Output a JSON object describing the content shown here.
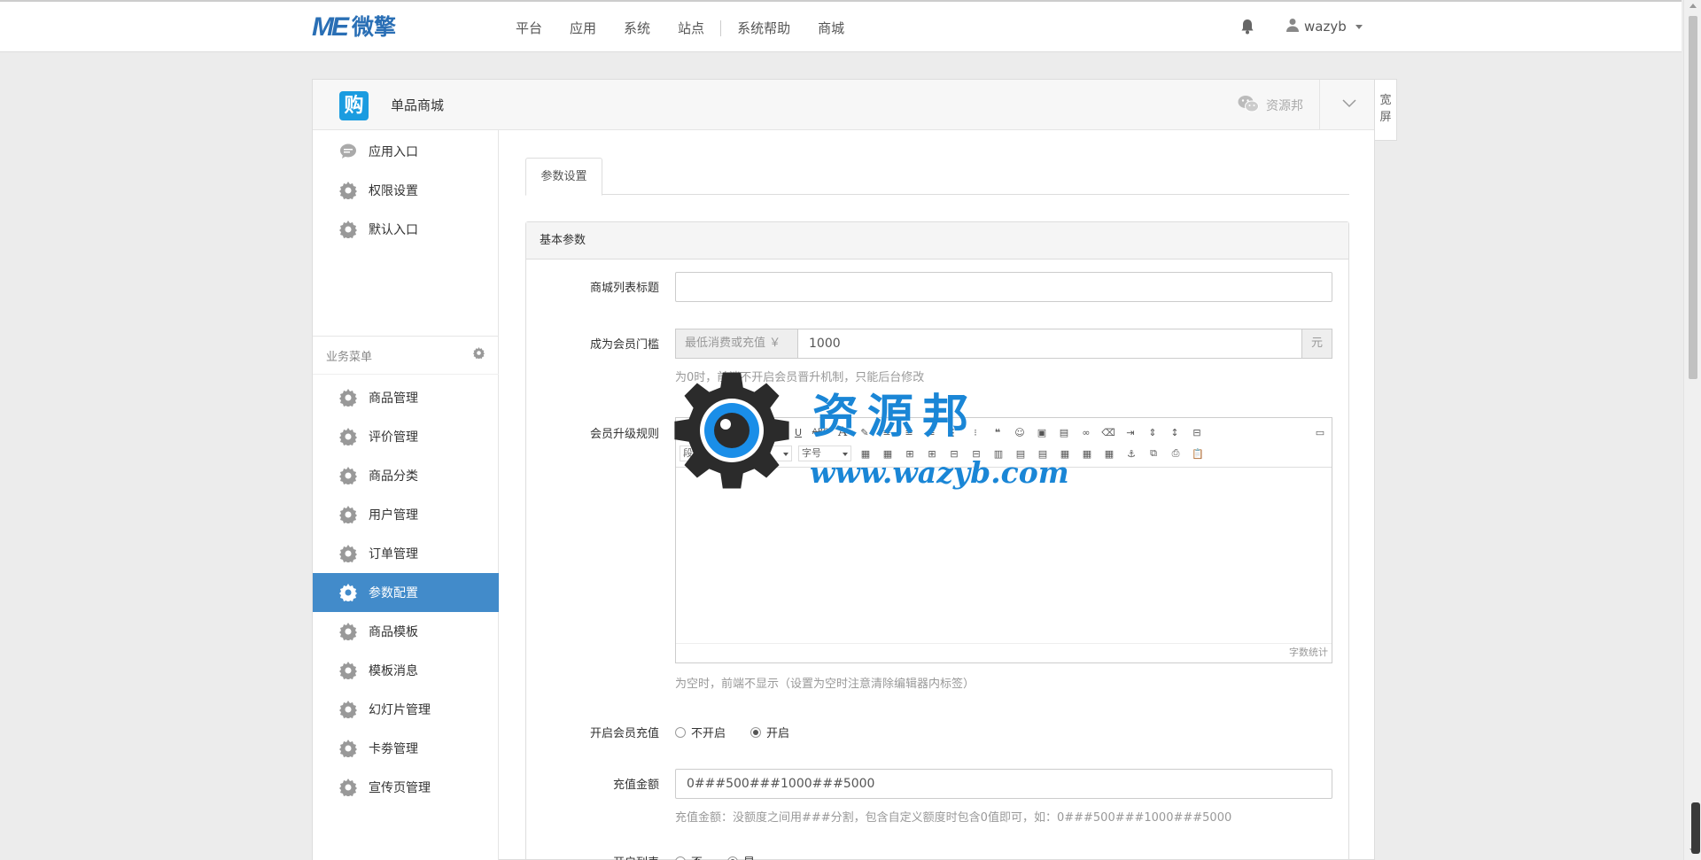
{
  "header": {
    "logo_mark": "ME",
    "logo_text": "微擎",
    "nav": [
      "平台",
      "应用",
      "系统",
      "站点",
      "系统帮助",
      "商城"
    ],
    "user": "wazyb"
  },
  "app": {
    "icon_text": "购",
    "name": "单品商城",
    "wechat_label": "资源邦",
    "wide_label_1": "宽",
    "wide_label_2": "屏"
  },
  "sidebar": {
    "top_items": [
      "应用入口",
      "权限设置",
      "默认入口"
    ],
    "group_title": "业务菜单",
    "items": [
      "商品管理",
      "评价管理",
      "商品分类",
      "用户管理",
      "订单管理",
      "参数配置",
      "商品模板",
      "模板消息",
      "幻灯片管理",
      "卡劵管理",
      "宣传页管理"
    ],
    "active": "参数配置"
  },
  "content": {
    "tab": "参数设置",
    "card_title": "基本参数",
    "fields": {
      "list_title": {
        "label": "商城列表标题",
        "value": ""
      },
      "member_threshold": {
        "label": "成为会员门槛",
        "prefix": "最低消费或充值 ￥",
        "value": "1000",
        "suffix": "元",
        "help": "为0时，前端不开启会员晋升机制，只能后台修改"
      },
      "upgrade_rule": {
        "label": "会员升级规则",
        "help": "为空时，前端不显示（设置为空时注意清除编辑器内标签）",
        "word_count": "字数统计"
      },
      "recharge_enable": {
        "label": "开启会员充值",
        "options": [
          "不开启",
          "开启"
        ],
        "selected": "开启"
      },
      "recharge_amount": {
        "label": "充值金额",
        "value": "0###500###1000###5000",
        "help": "充值金额：没额度之间用###分割，包含自定义额度时包含0值即可，如：0###500###1000###5000"
      },
      "list_enable": {
        "label": "开启列表",
        "options": [
          "否",
          "是"
        ],
        "selected": "是"
      }
    },
    "editor_toolbar": {
      "html_label": "HTML",
      "para_format": "段落格式",
      "font_family": "字体",
      "font_size": "字号"
    }
  },
  "watermark": {
    "title": "资源邦",
    "url": "www.wazyb.com"
  }
}
